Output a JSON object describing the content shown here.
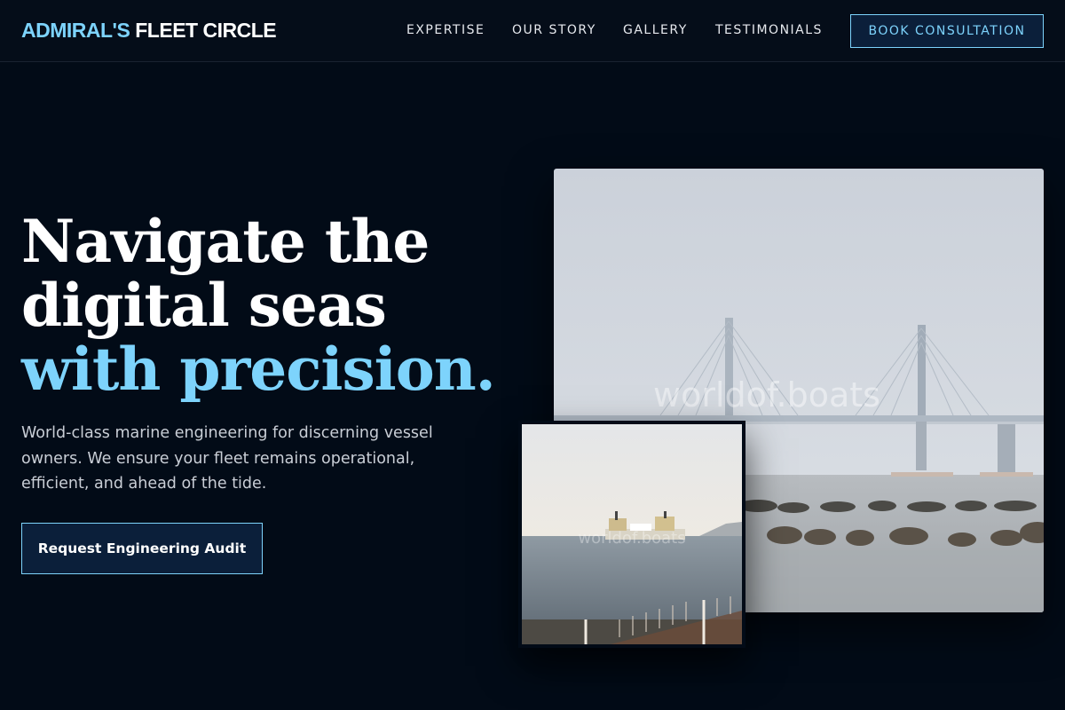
{
  "brand": {
    "accent": "ADMIRAL'S",
    "rest": "FLEET CIRCLE"
  },
  "nav": {
    "links": [
      "EXPERTISE",
      "OUR STORY",
      "GALLERY",
      "TESTIMONIALS"
    ],
    "cta_label": "BOOK CONSULTATION"
  },
  "hero": {
    "headline_line1": "Navigate the",
    "headline_line2": "digital seas",
    "headline_accent": "with precision.",
    "subtext": "World-class marine engineering for discerning vessel owners. We ensure your fleet remains operational, efficient, and ahead of the tide.",
    "cta_label": "Request Engineering Audit"
  },
  "images": {
    "large_watermark": "worldof.boats",
    "small_watermark": "worldof.boats"
  },
  "colors": {
    "background": "#020b17",
    "accent": "#7dd3fc",
    "button_fill": "#0b1f3a"
  }
}
